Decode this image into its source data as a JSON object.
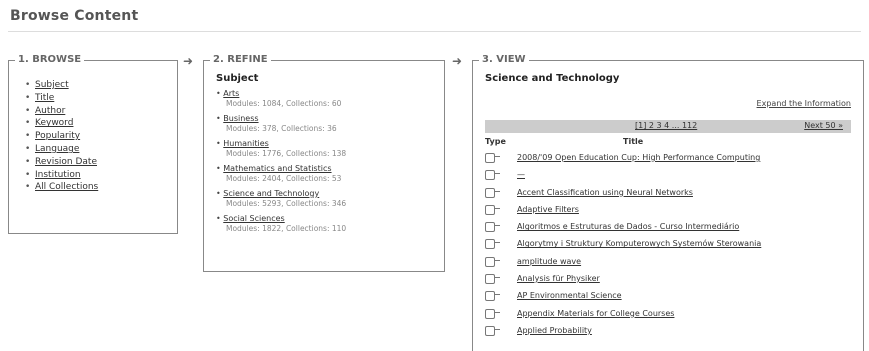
{
  "page": {
    "title": "Browse Content"
  },
  "browse": {
    "header": "1. BROWSE",
    "items": [
      "Subject",
      "Title",
      "Author",
      "Keyword",
      "Popularity",
      "Language",
      "Revision Date",
      "Institution",
      "All Collections"
    ]
  },
  "refine": {
    "header": "2. REFINE",
    "title": "Subject",
    "subjects": [
      {
        "name": "Arts",
        "meta": "Modules: 1084, Collections: 60"
      },
      {
        "name": "Business",
        "meta": "Modules: 378, Collections: 36"
      },
      {
        "name": "Humanities",
        "meta": "Modules: 1776, Collections: 138"
      },
      {
        "name": "Mathematics and Statistics",
        "meta": "Modules: 2404, Collections: 53"
      },
      {
        "name": "Science and Technology",
        "meta": "Modules: 5293, Collections: 346"
      },
      {
        "name": "Social Sciences",
        "meta": "Modules: 1822, Collections: 110"
      }
    ]
  },
  "view": {
    "header": "3. VIEW",
    "title": "Science and Technology",
    "expand_label": "Expand the Information",
    "pager": {
      "pages": "[1] 2 3 4 ... 112",
      "next": "Next 50 »"
    },
    "col_type": "Type",
    "col_title": "Title",
    "rows": [
      "2008/'09 Open Education Cup: High Performance Computing",
      "—",
      "Accent Classification using Neural Networks",
      "Adaptive Filters",
      "Algoritmos e Estruturas de Dados - Curso Intermediário",
      "Algorytmy i Struktury Komputerowych Systemów Sterowania",
      "amplitude wave",
      "Analysis für Physiker",
      "AP Environmental Science",
      "Appendix Materials for College Courses",
      "Applied Probability"
    ]
  }
}
